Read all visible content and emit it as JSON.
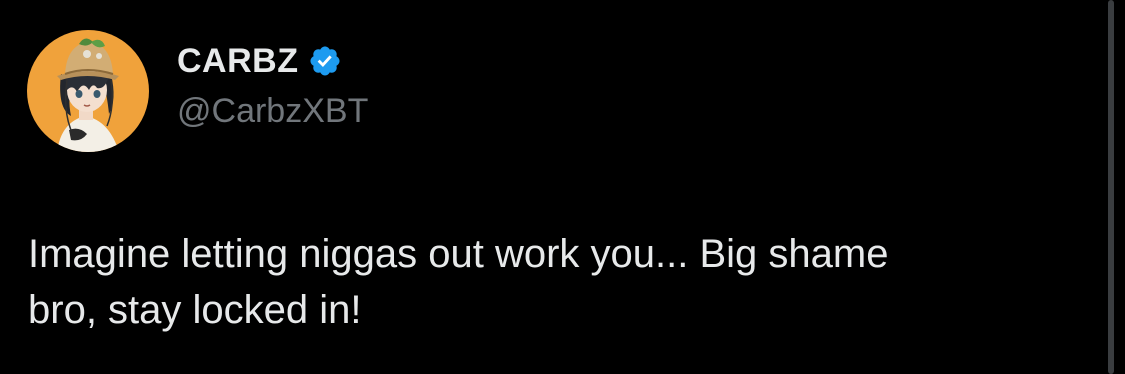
{
  "tweet": {
    "author": {
      "display_name": "CARBZ",
      "handle": "@CarbzXBT",
      "verified": true,
      "avatar_icon": "anime-character-avatar"
    },
    "text": "Imagine letting niggas out work you... Big shame\nbro, stay locked in!"
  },
  "colors": {
    "background": "#000000",
    "primary_text": "#e7e9ea",
    "secondary_text": "#71767b",
    "verified_badge": "#1d9bf0",
    "avatar_background": "#f0a23b"
  }
}
